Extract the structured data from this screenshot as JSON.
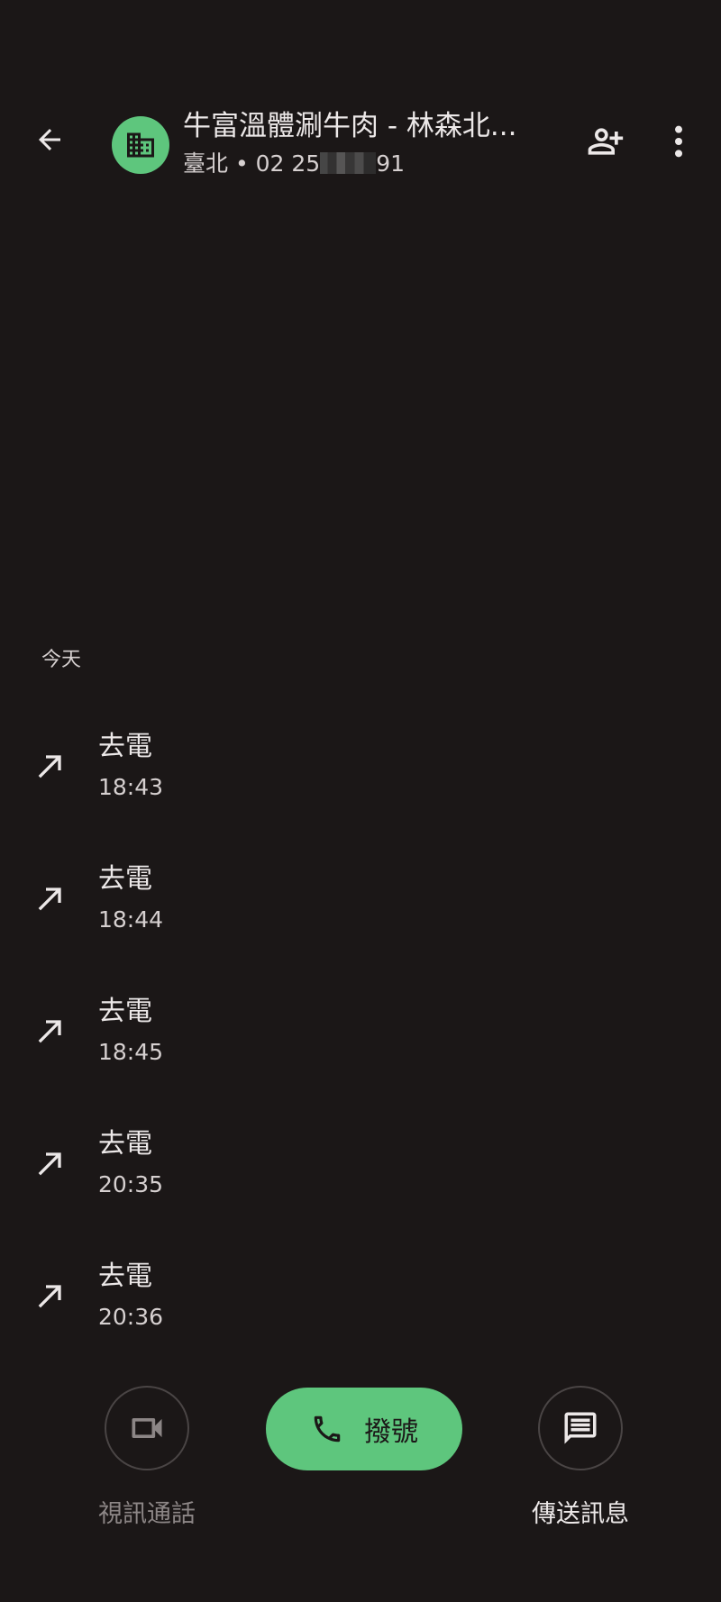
{
  "colors": {
    "background": "#1b1717",
    "accent_green": "#5ec67d",
    "text_primary": "#ece8e8",
    "text_secondary": "#d6d0d0",
    "text_disabled": "#8c8686"
  },
  "header": {
    "back_icon": "arrow-left-icon",
    "avatar_icon": "building-icon",
    "title": "牛富溫體涮牛肉 - 林森北...",
    "subtitle_prefix": "臺北 • 02 25",
    "subtitle_suffix": "91",
    "add_contact_icon": "person-add-icon",
    "more_icon": "more-vert-icon"
  },
  "section_label": "今天",
  "calls": [
    {
      "type": "去電",
      "time": "18:43",
      "icon": "outgoing-call-arrow-icon"
    },
    {
      "type": "去電",
      "time": "18:44",
      "icon": "outgoing-call-arrow-icon"
    },
    {
      "type": "去電",
      "time": "18:45",
      "icon": "outgoing-call-arrow-icon"
    },
    {
      "type": "去電",
      "time": "20:35",
      "icon": "outgoing-call-arrow-icon"
    },
    {
      "type": "去電",
      "time": "20:36",
      "icon": "outgoing-call-arrow-icon"
    }
  ],
  "actions": {
    "video_call_label": "視訊通話",
    "video_call_icon": "videocam-icon",
    "dial_label": "撥號",
    "dial_icon": "phone-icon",
    "message_label": "傳送訊息",
    "message_icon": "message-icon"
  }
}
